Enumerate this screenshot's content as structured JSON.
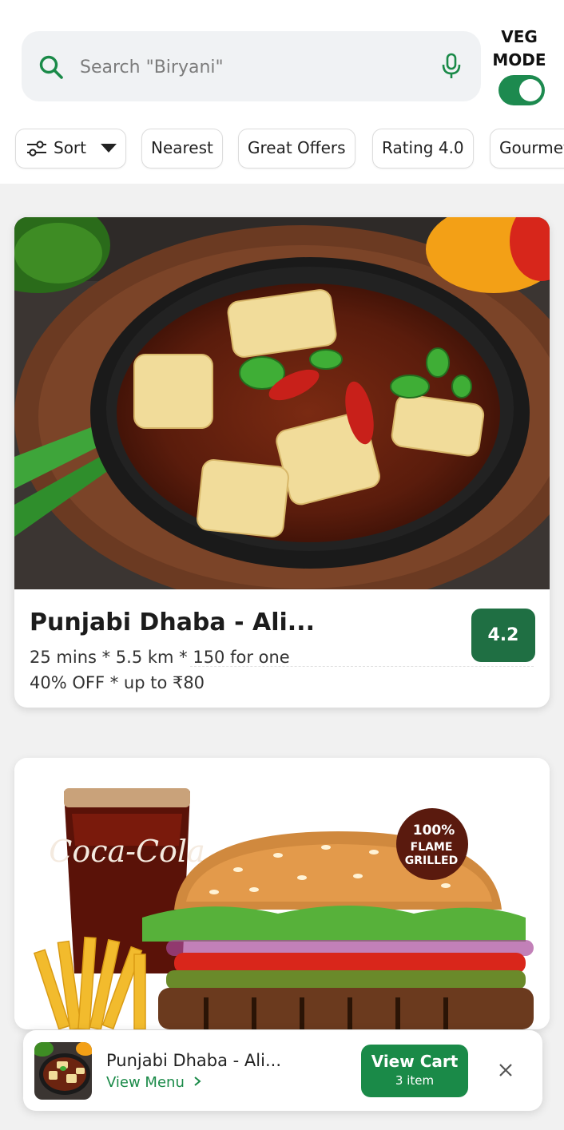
{
  "search": {
    "placeholder": "Search \"Biryani\"",
    "icon": "search-icon",
    "voice_icon": "mic-icon"
  },
  "veg_mode": {
    "label_line1": "VEG",
    "label_line2": "MODE",
    "enabled": true,
    "color": "#1d8a4f"
  },
  "filters": {
    "sort_label": "Sort",
    "chips": [
      "Nearest",
      "Great Offers",
      "Rating 4.0",
      "Gourmet"
    ]
  },
  "restaurants": [
    {
      "name": "Punjabi Dhaba - Ali...",
      "meta": "25 mins * 5.5 km * 150 for one",
      "offer": "40% OFF * up to ₹80",
      "rating": "4.2",
      "rating_color": "#1f6f43"
    },
    {
      "image_text_brand": "Coca-Cola",
      "image_text_badge_1": "100%",
      "image_text_badge_2": "FLAME",
      "image_text_badge_3": "GRILLED"
    }
  ],
  "cart": {
    "restaurant_name": "Punjabi Dhaba - Ali...",
    "view_menu_label": "View Menu",
    "view_cart_label": "View Cart",
    "item_count_label": "3 item",
    "accent_color": "#1a8a48"
  }
}
